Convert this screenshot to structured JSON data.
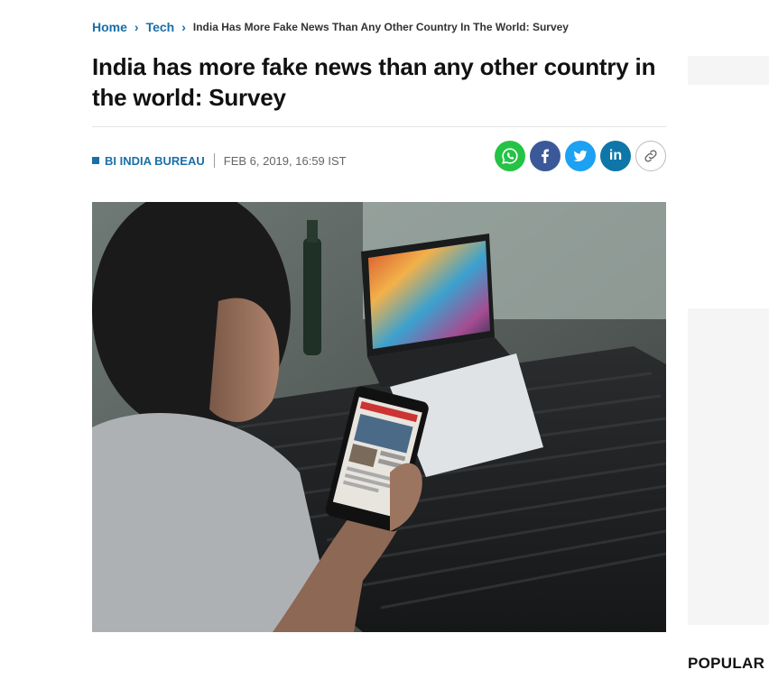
{
  "breadcrumb": {
    "home": "Home",
    "section": "Tech",
    "current": "India Has More Fake News Than Any Other Country In The World: Survey"
  },
  "article": {
    "title": "India has more fake news than any other country in the world: Survey",
    "author": "BI INDIA BUREAU",
    "date": "FEB 6, 2019, 16:59 IST"
  },
  "share": {
    "buttons": [
      "whatsapp-icon",
      "facebook-icon",
      "twitter-icon",
      "linkedin-icon",
      "link-icon"
    ],
    "linkedin_text": "in"
  },
  "sidebar": {
    "popular_heading": "POPULAR"
  },
  "colors": {
    "link_blue": "#1a6fa8",
    "whatsapp": "#25c345",
    "facebook": "#3b5998",
    "twitter": "#1da1f2",
    "linkedin": "#0e76a8"
  }
}
